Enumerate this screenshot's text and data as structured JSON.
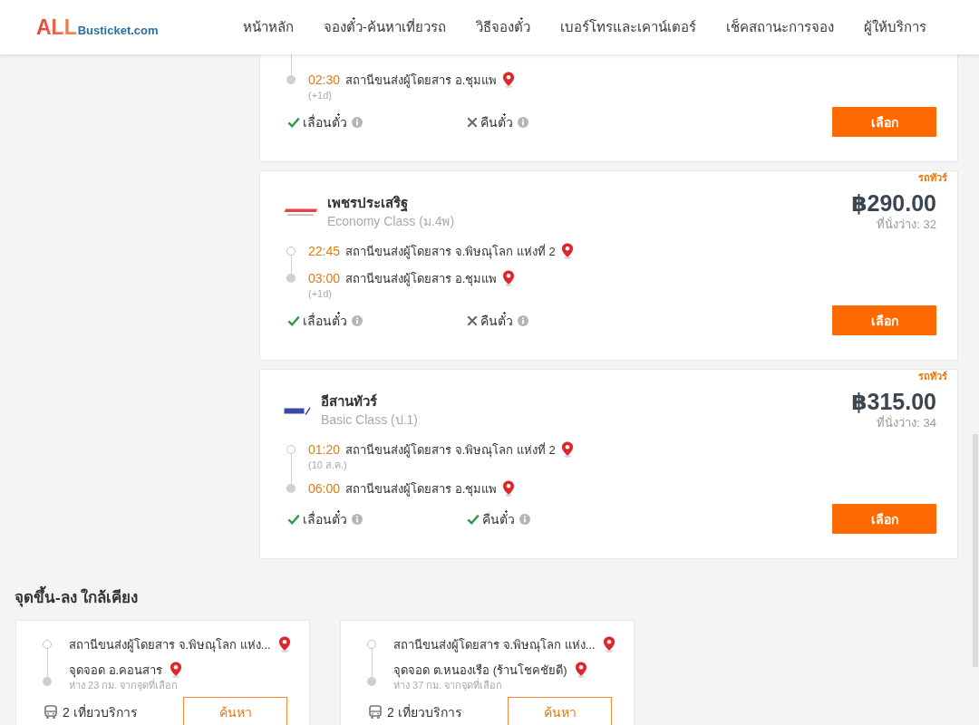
{
  "header": {
    "logo": {
      "brand": "ALL",
      "domain": "Busticket.com"
    },
    "nav": [
      "หน้าหลัก",
      "จองตั๋ว-ค้นหาเที่ยวรถ",
      "วิธีจองตั๋ว",
      "เบอร์โทรและเคาน์เตอร์",
      "เช็คสถานะการจอง",
      "ผู้ให้บริการ"
    ]
  },
  "trips": [
    {
      "clipped_top": true,
      "stops": [
        {
          "kind": "arrival",
          "time": "02:30",
          "station": "สถานีขนส่งผู้โดยสาร อ.ชุมแพ",
          "note": "(+1d)"
        }
      ],
      "features": [
        {
          "label": "เลื่อนตั๋ว",
          "available": true
        },
        {
          "label": "คืนตั๋ว",
          "available": false
        }
      ],
      "button": "เลือก"
    },
    {
      "clipped_top": false,
      "vehicle": "รถทัวร์",
      "operator": {
        "name": "เพชรประเสริฐ",
        "class": "Economy Class (ม.4พ)",
        "logo": {
          "kind": "banner"
        }
      },
      "price": "฿290.00",
      "seats": "ที่นั่งว่าง: 32",
      "stops": [
        {
          "kind": "departure",
          "time": "22:45",
          "station": "สถานีขนส่งผู้โดยสาร จ.พิษณุโลก แห่งที่ 2"
        },
        {
          "kind": "arrival",
          "time": "03:00",
          "station": "สถานีขนส่งผู้โดยสาร อ.ชุมแพ",
          "note": "(+1d)"
        }
      ],
      "features": [
        {
          "label": "เลื่อนตั๋ว",
          "available": true
        },
        {
          "label": "คืนตั๋ว",
          "available": false
        }
      ],
      "button": "เลือก"
    },
    {
      "clipped_top": false,
      "vehicle": "รถทัวร์",
      "operator": {
        "name": "อีสานทัวร์",
        "class": "Basic Class (ป.1)",
        "logo": {
          "kind": "script"
        }
      },
      "price": "฿315.00",
      "seats": "ที่นั่งว่าง: 34",
      "stops": [
        {
          "kind": "departure",
          "time": "01:20",
          "station": "สถานีขนส่งผู้โดยสาร จ.พิษณุโลก แห่งที่ 2",
          "note": "(10 ส.ค.)"
        },
        {
          "kind": "arrival",
          "time": "06:00",
          "station": "สถานีขนส่งผู้โดยสาร อ.ชุมแพ"
        }
      ],
      "features": [
        {
          "label": "เลื่อนตั๋ว",
          "available": true
        },
        {
          "label": "คืนตั๋ว",
          "available": true
        }
      ],
      "button": "เลือก"
    }
  ],
  "nearby": {
    "title": "จุดขึ้น-ลง ใกล้เคียง",
    "items": [
      {
        "from": "สถานีขนส่งผู้โดยสาร จ.พิษณุโลก แห่ง...",
        "to": "จุดจอด อ.คอนสาร",
        "distance": "ห่าง 23 กม. จากจุดที่เลือก",
        "trips": "2 เที่ยวบริการ",
        "button": "ค้นหา"
      },
      {
        "from": "สถานีขนส่งผู้โดยสาร จ.พิษณุโลก แห่ง...",
        "to": "จุดจอด ต.หนองเรือ (ร้านโชคชัยดี)",
        "distance": "ห่าง 37 กม. จากจุดที่เลือก",
        "trips": "2 เที่ยวบริการ",
        "button": "ค้นหา"
      }
    ]
  }
}
